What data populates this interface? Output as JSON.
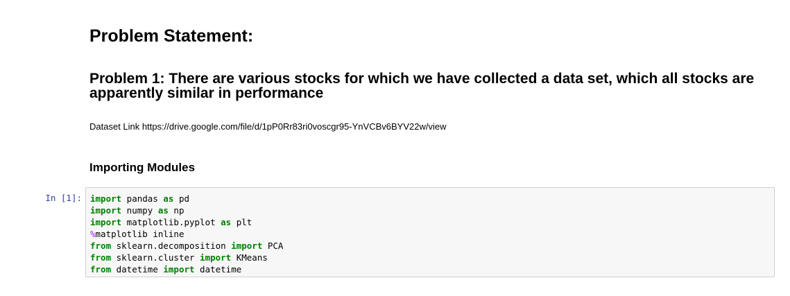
{
  "markdown": {
    "heading1": "Problem Statement:",
    "heading2": "Problem 1: There are various stocks for which we have collected a data set, which all stocks are apparently similar in performance",
    "dataset_paragraph": "Dataset Link https://drive.google.com/file/d/1pP0Rr83ri0voscgr95-YnVCBv6BYV22w/view",
    "heading3": "Importing Modules"
  },
  "code_cell": {
    "prompt": "In [1]:",
    "lines": [
      [
        {
          "t": "import",
          "k": "kw"
        },
        {
          "t": " pandas "
        },
        {
          "t": "as",
          "k": "kw"
        },
        {
          "t": " pd"
        }
      ],
      [
        {
          "t": "import",
          "k": "kw"
        },
        {
          "t": " numpy "
        },
        {
          "t": "as",
          "k": "kw"
        },
        {
          "t": " np"
        }
      ],
      [
        {
          "t": "import",
          "k": "kw"
        },
        {
          "t": " matplotlib.pyplot "
        },
        {
          "t": "as",
          "k": "kw"
        },
        {
          "t": " plt"
        }
      ],
      [
        {
          "t": "%",
          "k": "magic"
        },
        {
          "t": "matplotlib inline"
        }
      ],
      [
        {
          "t": "from",
          "k": "kw"
        },
        {
          "t": " sklearn.decomposition "
        },
        {
          "t": "import",
          "k": "kw"
        },
        {
          "t": " PCA"
        }
      ],
      [
        {
          "t": "from",
          "k": "kw"
        },
        {
          "t": " sklearn.cluster "
        },
        {
          "t": "import",
          "k": "kw"
        },
        {
          "t": " KMeans"
        }
      ],
      [
        {
          "t": "from",
          "k": "kw"
        },
        {
          "t": " datetime "
        },
        {
          "t": "import",
          "k": "kw"
        },
        {
          "t": " datetime"
        }
      ]
    ]
  },
  "colors": {
    "keyword": "#008000",
    "magic": "#aa22ff",
    "prompt": "#303f9f",
    "cell_background": "#f7f7f7",
    "cell_border": "#cfcfcf"
  }
}
